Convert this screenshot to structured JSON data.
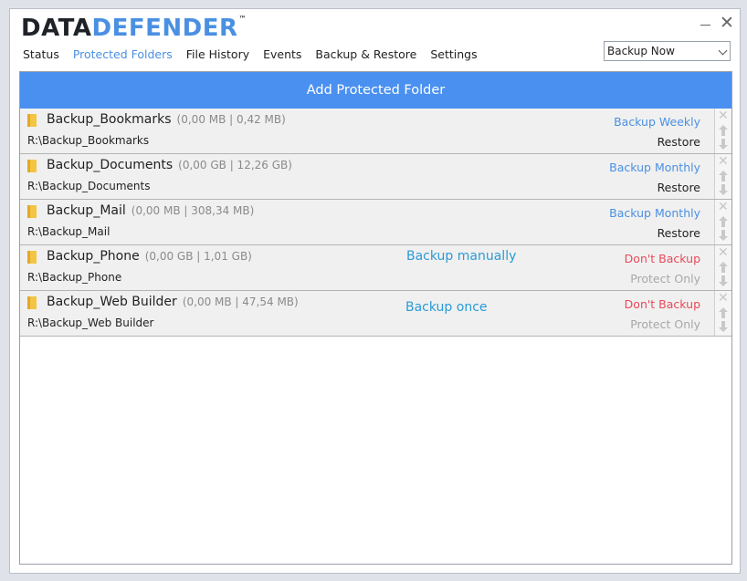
{
  "app": {
    "logo_part1": "DATA",
    "logo_part2": "DEFENDER",
    "logo_tm": "™"
  },
  "window_controls": {
    "minimize": "",
    "close": "✕"
  },
  "nav": {
    "tabs": [
      {
        "label": "Status",
        "active": false
      },
      {
        "label": "Protected Folders",
        "active": true
      },
      {
        "label": "File History",
        "active": false
      },
      {
        "label": "Events",
        "active": false
      },
      {
        "label": "Backup & Restore",
        "active": false
      },
      {
        "label": "Settings",
        "active": false
      }
    ]
  },
  "action_select": {
    "value": "Backup Now"
  },
  "add_button": {
    "label": "Add Protected Folder"
  },
  "folders": [
    {
      "name": "Backup_Bookmarks",
      "size": "(0,00 MB | 0,42 MB)",
      "path": "R:\\Backup_Bookmarks",
      "schedule": "Backup Weekly",
      "schedule_color": "#4a90e2",
      "action": "Restore",
      "action_color": "#222222",
      "note": ""
    },
    {
      "name": "Backup_Documents",
      "size": "(0,00 GB | 12,26 GB)",
      "path": "R:\\Backup_Documents",
      "schedule": "Backup Monthly",
      "schedule_color": "#4a90e2",
      "action": "Restore",
      "action_color": "#222222",
      "note": ""
    },
    {
      "name": "Backup_Mail",
      "size": "(0,00 MB | 308,34 MB)",
      "path": "R:\\Backup_Mail",
      "schedule": "Backup Monthly",
      "schedule_color": "#4a90e2",
      "action": "Restore",
      "action_color": "#222222",
      "note": ""
    },
    {
      "name": "Backup_Phone",
      "size": "(0,00 GB | 1,01 GB)",
      "path": "R:\\Backup_Phone",
      "schedule": "Don't Backup",
      "schedule_color": "#e8495a",
      "action": "Protect Only",
      "action_color": "#a8a8a8",
      "note": "Backup manually"
    },
    {
      "name": "Backup_Web Builder",
      "size": "(0,00 MB | 47,54 MB)",
      "path": "R:\\Backup_Web Builder",
      "schedule": "Don't Backup",
      "schedule_color": "#e8495a",
      "action": "Protect Only",
      "action_color": "#a8a8a8",
      "note": "Backup once"
    }
  ],
  "icons": {
    "folder": "folder-icon",
    "remove": "close-icon",
    "move_up": "arrow-up-icon",
    "move_down": "arrow-down-icon"
  },
  "colors": {
    "accent": "#4a90f0",
    "link_blue": "#4a90e2",
    "danger": "#e8495a",
    "annotation": "#2a9bd6"
  }
}
